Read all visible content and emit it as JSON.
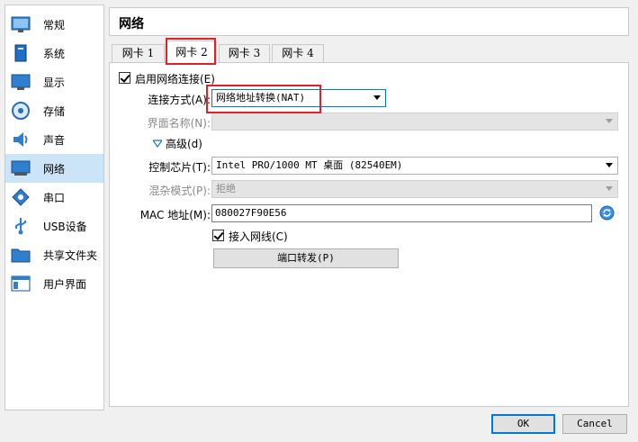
{
  "sidebar": {
    "items": [
      {
        "label": "常规",
        "icon": "general-icon"
      },
      {
        "label": "系统",
        "icon": "system-icon"
      },
      {
        "label": "显示",
        "icon": "display-icon"
      },
      {
        "label": "存储",
        "icon": "storage-icon"
      },
      {
        "label": "声音",
        "icon": "audio-icon"
      },
      {
        "label": "网络",
        "icon": "network-icon"
      },
      {
        "label": "串口",
        "icon": "serial-port-icon"
      },
      {
        "label": "USB设备",
        "icon": "usb-icon"
      },
      {
        "label": "共享文件夹",
        "icon": "shared-folder-icon"
      },
      {
        "label": "用户界面",
        "icon": "user-interface-icon"
      }
    ],
    "selected": "网络"
  },
  "page": {
    "title": "网络"
  },
  "tabs": [
    "网卡 1",
    "网卡 2",
    "网卡 3",
    "网卡 4"
  ],
  "active_tab": "网卡 2",
  "form": {
    "enable_label": "启用网络连接(E)",
    "enable_checked": true,
    "attached_label": "连接方式(A):",
    "attached_value": "网络地址转换(NAT)",
    "name_label": "界面名称(N):",
    "name_value": "",
    "advanced_label": "高级(d)",
    "adapter_label": "控制芯片(T):",
    "adapter_value": "Intel PRO/1000 MT 桌面 (82540EM)",
    "promisc_label": "混杂模式(P):",
    "promisc_value": "拒绝",
    "mac_label": "MAC 地址(M):",
    "mac_value": "080027F90E56",
    "cable_label": "接入网线(C)",
    "cable_checked": true,
    "port_forward_label": "端口转发(P)"
  },
  "footer": {
    "ok_label": "OK",
    "cancel_label": "Cancel"
  },
  "colors": {
    "selection": "#cce4f7",
    "highlight_box": "#e0202a",
    "focus_border": "#0078d7"
  }
}
